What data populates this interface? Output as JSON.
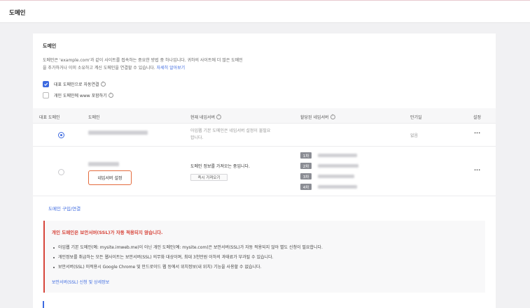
{
  "header": {
    "title": "도메인"
  },
  "section": {
    "title": "도메인",
    "desc_line1": "도메인은 'example.com'과 같이 사이트를 접속하는 중요한 방법 중 하나입니다. 귀하의 사이트에 더 많은 도메인",
    "desc_line2": "을 추가하거나 이미 소유하고 계신 도메인을 연결할 수 있습니다.",
    "learn_more": "자세히 알아보기",
    "checkbox_primary_redirect": "대표 도메인으로 자동연결",
    "checkbox_www": "개인 도메인에 www 포함하기"
  },
  "table": {
    "headers": {
      "primary": "대표 도메인",
      "domain": "도메인",
      "current_ns": "현재 네임서버",
      "assigned_ns": "할당된 네임서버",
      "expiry": "만기일",
      "settings": "설정"
    },
    "rows": [
      {
        "ns_text_line1": "아임웹 기본 도메인은 네임서버 설정이 불필요",
        "ns_text_line2": "합니다.",
        "expiry": "없음",
        "more": "···"
      },
      {
        "nameserver_button": "네임서버 설정",
        "ns_text": "도메인 정보를 가져오는 중입니다.",
        "fetch_button": "즉시 가져오기",
        "ns_tags": [
          "1차",
          "2차",
          "3차",
          "4차"
        ],
        "more": "···"
      }
    ]
  },
  "buy_link": "도메인 구입/연결",
  "warning": {
    "title": "개인 도메인은 보안서버(SSL)가 자동 적용되지 않습니다.",
    "items": [
      "아임웹 기본 도메인(예: mysite.imweb.me)이 아닌 개인 도메인(예: mysite.com)은 보안서버(SSL)가 자동 적용되지 않아 별도 신청이 필요합니다.",
      "개인정보를 취급하는 모든 웹사이트는 보안서버(SSL) 의무화 대상이며, 최대 3천만원 이하의 과태료가 부과될 수 있습니다.",
      "보안서버(SSL) 미적용시 Google Chrome 및 안드로이드 웹 등에서 위치정보(내 위치) 기능을 사용할 수 없습니다."
    ],
    "link": "보안서버(SSL) 신청 및 상세정보"
  },
  "colors": {
    "accent": "#3d6ae0",
    "warning": "#d7453b",
    "highlight": "#e46b3d"
  }
}
